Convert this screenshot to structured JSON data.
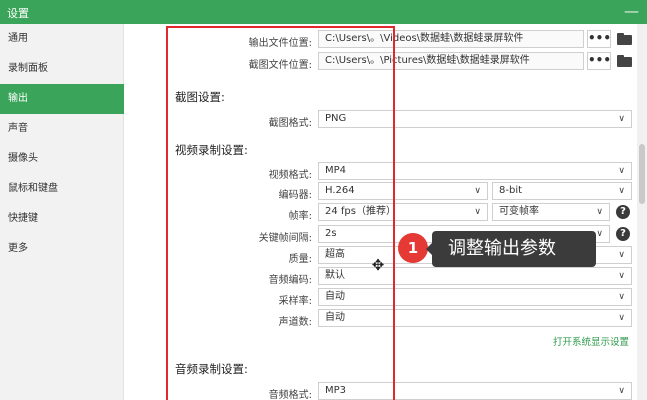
{
  "window": {
    "title": "设置",
    "close_glyph": "—"
  },
  "sidebar": {
    "items": [
      {
        "label": "通用"
      },
      {
        "label": "录制面板"
      },
      {
        "label": "输出"
      },
      {
        "label": "声音"
      },
      {
        "label": "摄像头"
      },
      {
        "label": "鼠标和键盘"
      },
      {
        "label": "快捷键"
      },
      {
        "label": "更多"
      }
    ],
    "active_index": 2
  },
  "output": {
    "output_path_label": "输出文件位置:",
    "output_path_value": "C:\\Users\\。\\Videos\\数据蛙\\数据蛙录屏软件",
    "screenshot_path_label": "截图文件位置:",
    "screenshot_path_value": "C:\\Users\\。\\Pictures\\数据蛙\\数据蛙录屏软件",
    "browse_glyph": "•••"
  },
  "screenshot_settings": {
    "title": "截图设置:",
    "format_label": "截图格式:",
    "format_value": "PNG"
  },
  "video_settings": {
    "title": "视频录制设置:",
    "format_label": "视频格式:",
    "format_value": "MP4",
    "encoder_label": "编码器:",
    "encoder_value": "H.264",
    "bitdepth_value": "8-bit",
    "framerate_label": "帧率:",
    "framerate_value": "24 fps（推荐）",
    "framerate_mode_value": "可变帧率",
    "keyframe_label": "关键帧间隔:",
    "keyframe_value": "2s",
    "quality_label": "质量:",
    "quality_value": "超高",
    "audio_codec_label": "音频编码:",
    "audio_codec_value": "默认",
    "samplerate_label": "采样率:",
    "samplerate_value": "自动",
    "channels_label": "声道数:",
    "channels_value": "自动",
    "display_settings_link": "打开系统显示设置"
  },
  "audio_settings": {
    "title": "音频录制设置:",
    "format_label": "音频格式:",
    "format_value": "MP3"
  },
  "annotation": {
    "step_number": "1",
    "text": "调整输出参数"
  },
  "icons": {
    "chevron": "∨",
    "help": "?",
    "move": "✥"
  },
  "colors": {
    "accent": "#3aa55a",
    "highlight_box": "#e0282d",
    "badge": "#e53935",
    "callout_bg": "#3b3b3b"
  }
}
